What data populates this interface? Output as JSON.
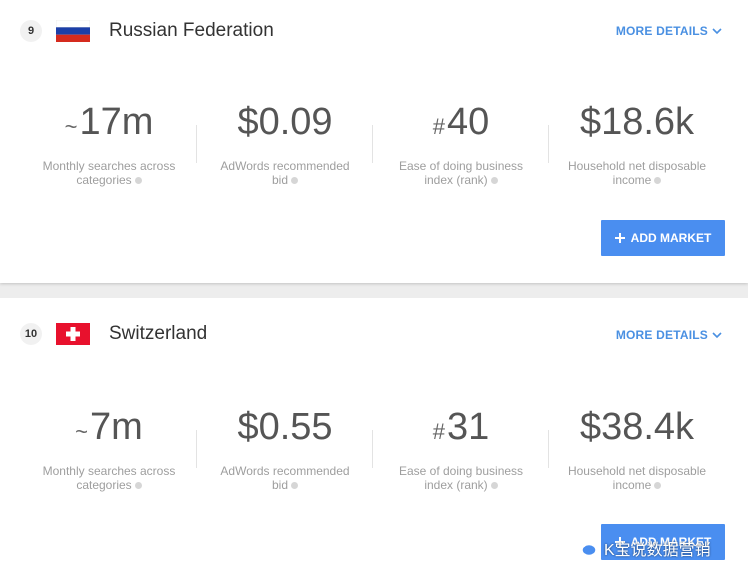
{
  "markets": [
    {
      "rank": "9",
      "country": "Russian Federation",
      "flag": "russia-flag",
      "more_details": "MORE DETAILS",
      "searches": {
        "prefix": "~",
        "value": "17m",
        "line1": "Monthly searches across",
        "line2": "categories"
      },
      "bid": {
        "value": "$0.09",
        "line1": "AdWords recommended",
        "line2": "bid"
      },
      "ease": {
        "prefix": "#",
        "value": "40",
        "line1": "Ease of doing business",
        "line2": "index (rank)"
      },
      "income": {
        "value": "$18.6k",
        "line1": "Household net disposable",
        "line2": "income"
      },
      "add_market": "ADD MARKET"
    },
    {
      "rank": "10",
      "country": "Switzerland",
      "flag": "switzerland-flag",
      "more_details": "MORE DETAILS",
      "searches": {
        "prefix": "~",
        "value": "7m",
        "line1": "Monthly searches across",
        "line2": "categories"
      },
      "bid": {
        "value": "$0.55",
        "line1": "AdWords recommended",
        "line2": "bid"
      },
      "ease": {
        "prefix": "#",
        "value": "31",
        "line1": "Ease of doing business",
        "line2": "index (rank)"
      },
      "income": {
        "value": "$38.4k",
        "line1": "Household net disposable",
        "line2": "income"
      },
      "add_market": "ADD MARKET"
    }
  ],
  "watermark": "K宝说数据营销",
  "colors": {
    "accent": "#4a8ef0",
    "link": "#4a90e2",
    "russia": [
      "#ffffff",
      "#1c3fa8",
      "#d52b1e"
    ],
    "swiss": "#e8112d"
  }
}
